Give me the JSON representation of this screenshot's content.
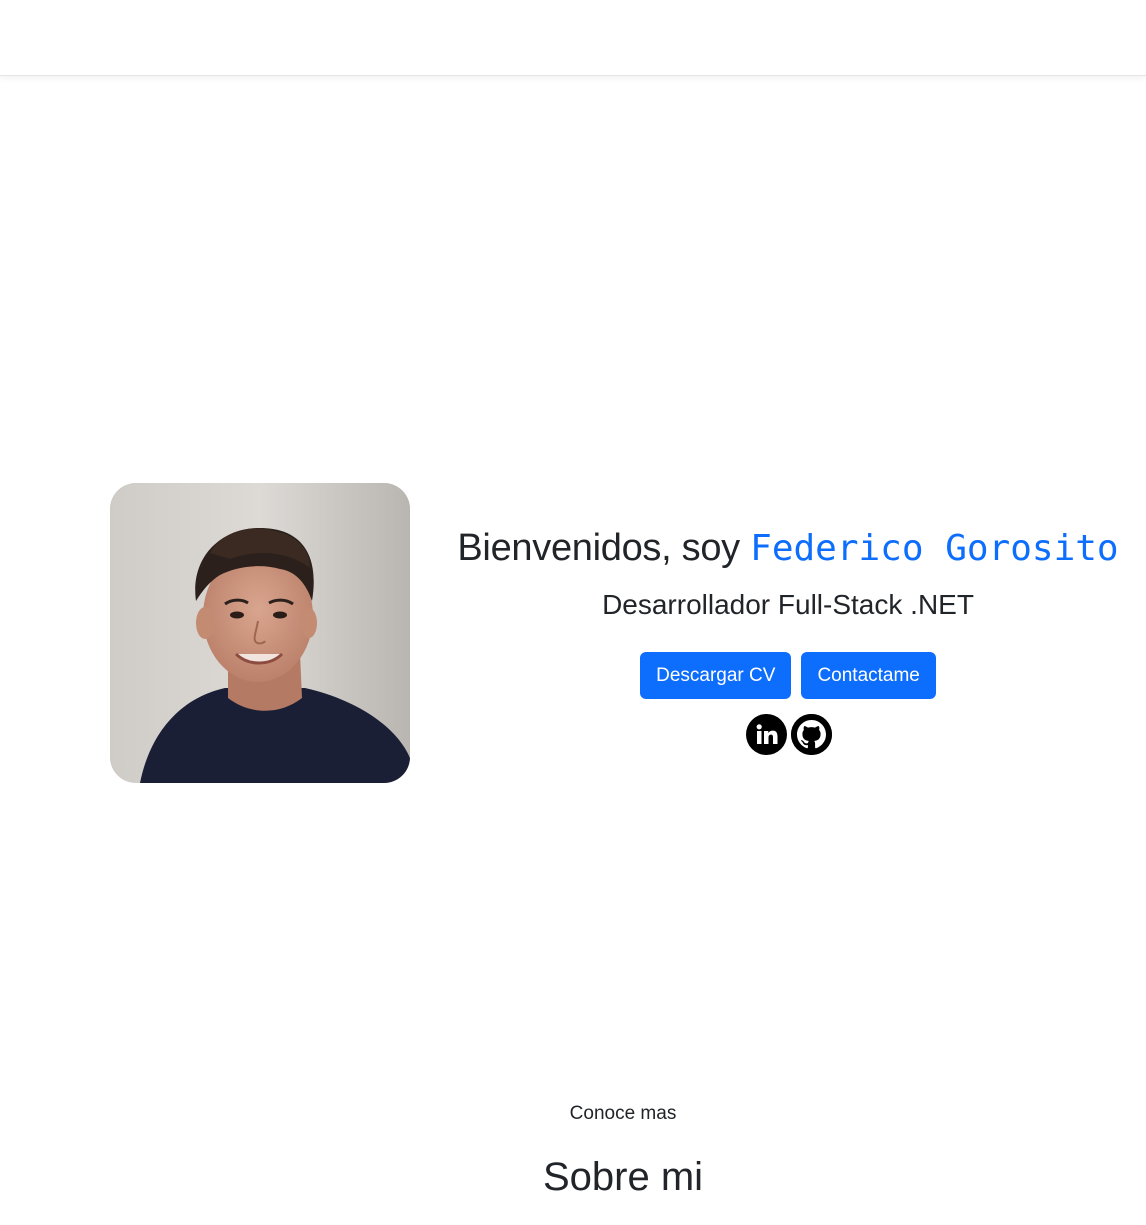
{
  "hero": {
    "greeting": "Bienvenidos, soy ",
    "name": "Federico Gorosito",
    "role": "Desarrollador Full-Stack .NET",
    "buttons": {
      "download_cv": "Descargar CV",
      "contact": "Contactame"
    },
    "socials": [
      {
        "icon": "linkedin-icon"
      },
      {
        "icon": "github-icon"
      }
    ]
  },
  "about": {
    "kicker": "Conoce mas",
    "title": "Sobre mi"
  },
  "colors": {
    "accent": "#0d6efd",
    "text": "#212529",
    "background": "#ffffff"
  }
}
